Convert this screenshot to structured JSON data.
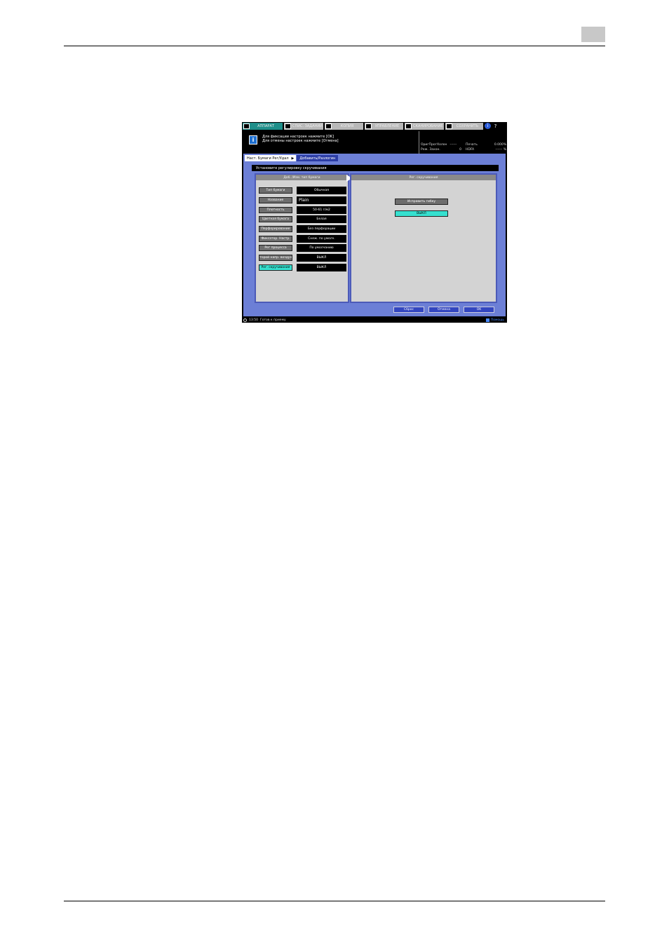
{
  "top_tabs": [
    {
      "label": "АППАРАТ",
      "active": true
    },
    {
      "label": "СПИС. ЗАДАНИЙ",
      "active": false
    },
    {
      "label": "КОПИЯ",
      "active": false
    },
    {
      "label": "УПРАВЛЕНИЕ",
      "active": false
    },
    {
      "label": "СКАНИРОВАНИЕ",
      "active": false
    },
    {
      "label": "СОХРАНИТЬ",
      "active": false
    }
  ],
  "help_labels": {
    "info": "i",
    "help": "?"
  },
  "message": {
    "info_glyph": "i",
    "line1": "Для фиксации настроек нажмите [OK]",
    "line2": "Для отмены настроек нажмите [Отмена]"
  },
  "status": {
    "r1a": "ОригПрогХолон",
    "r1b": "------",
    "r1c": "Печать",
    "r1d": "0.000%",
    "r2a": "Реж. Захон.",
    "r2b": "0",
    "r2c": "HDFA",
    "r2d": "------ %"
  },
  "breadcrumb": {
    "item1": "Наст. Бумаги Рег/Удал",
    "arrow": "▶",
    "item2": "Добавить/Разлогин"
  },
  "instruction": "Установите регулировку скручивания",
  "left_panel": {
    "title": "Доб. /Изм. тип бумаги",
    "rows": [
      {
        "label": "Тип бумаги",
        "value": "Обычная"
      },
      {
        "label": "Название",
        "value": "Plain"
      },
      {
        "label": "Плотность",
        "value": "50-61 г/м2"
      },
      {
        "label": "Цветная бумага",
        "value": "Белая"
      },
      {
        "label": "Перфорирование",
        "value": "Без перфорации"
      },
      {
        "label": "Фиксатор. Настр.",
        "value": "Снеж. по умолч."
      },
      {
        "label": "Рег процесса",
        "value": "По умолчанию"
      },
      {
        "label": "Второй напр. воздуха",
        "value": "ВЫКЛ"
      },
      {
        "label": "Рег. скручивания",
        "value": "ВЫКЛ"
      }
    ]
  },
  "right_panel": {
    "title": "Рег. скручивания",
    "btn_flatten": "Исправить гибку",
    "btn_off": "ВЫКЛ"
  },
  "buttons": {
    "reset": "Сброс",
    "cancel": "Отмена",
    "ok": "OK"
  },
  "footer": {
    "time": "13:50",
    "status": "Готов к приему",
    "right": "Помощь"
  }
}
